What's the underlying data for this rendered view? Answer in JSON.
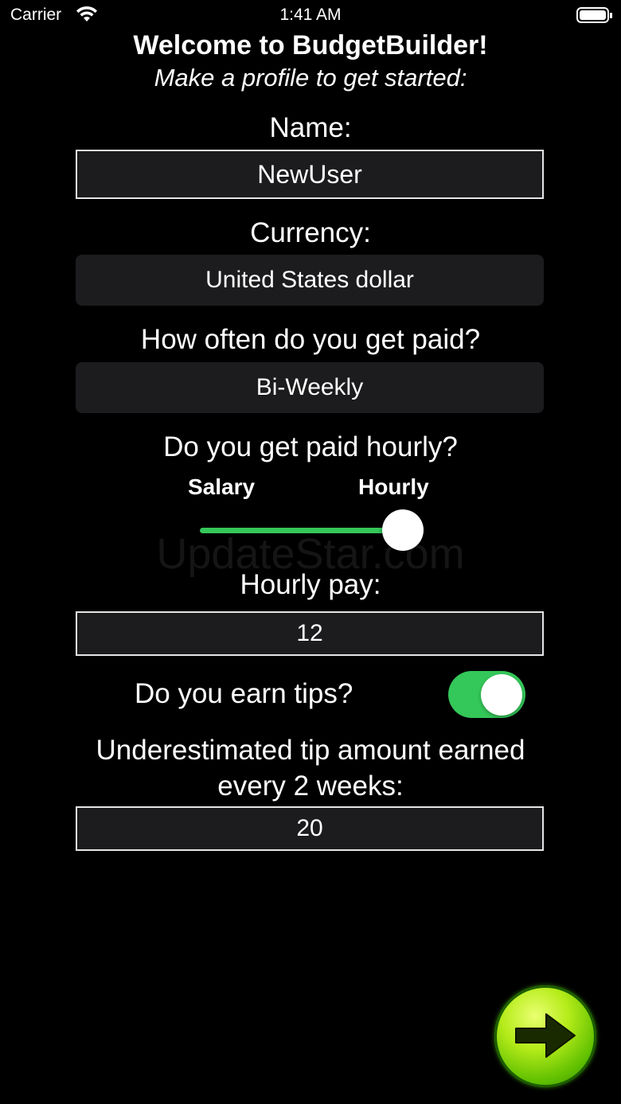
{
  "status_bar": {
    "carrier": "Carrier",
    "time": "1:41 AM"
  },
  "header": {
    "title": "Welcome to BudgetBuilder!",
    "subtitle": "Make a profile to get started:"
  },
  "form": {
    "name_label": "Name:",
    "name_value": "NewUser",
    "currency_label": "Currency:",
    "currency_value": "United States dollar",
    "frequency_label": "How often do you get paid?",
    "frequency_value": "Bi-Weekly",
    "hourly_question": "Do you get paid hourly?",
    "salary_option": "Salary",
    "hourly_option": "Hourly",
    "pay_type_slider_value": 1.0,
    "hourly_pay_label": "Hourly pay:",
    "hourly_pay_value": "12",
    "tips_label": "Do you earn tips?",
    "tips_enabled": true,
    "tip_amount_label_line1": "Underestimated tip amount earned",
    "tip_amount_label_line2": "every 2 weeks:",
    "tip_amount_value": "20"
  },
  "watermark": "UpdateStar.com",
  "colors": {
    "background": "#000000",
    "accent_green": "#34c759",
    "field_background": "#1c1c1e"
  },
  "icons": {
    "wifi": "wifi-icon",
    "battery": "battery-icon",
    "next": "arrow-right-icon"
  }
}
